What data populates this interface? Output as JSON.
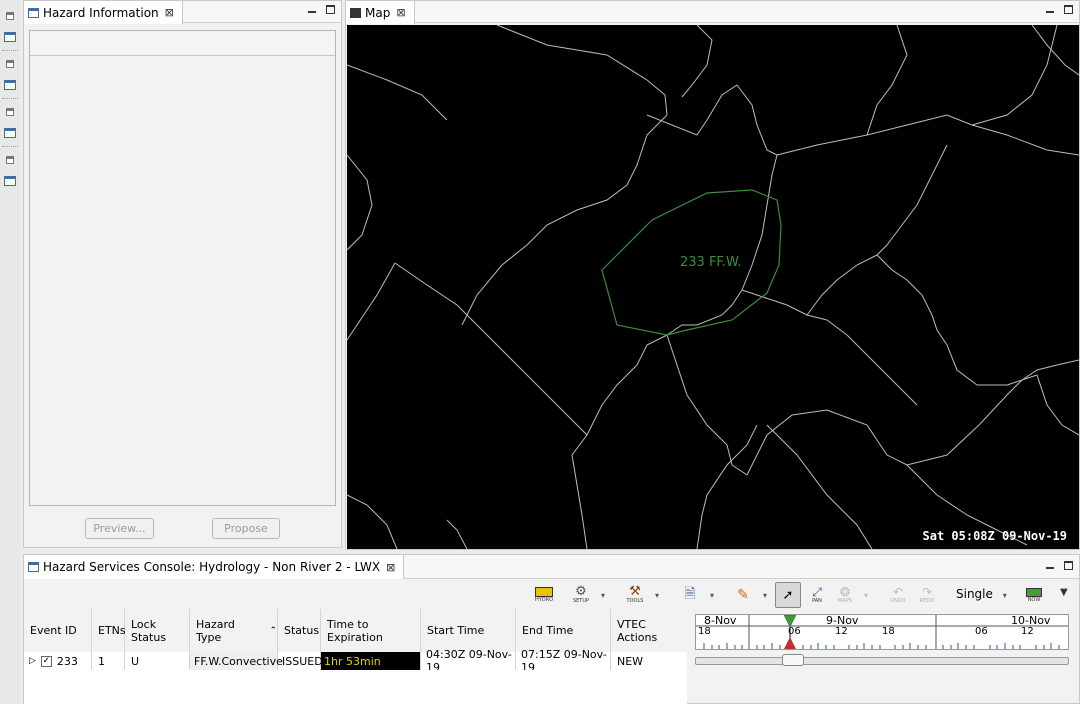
{
  "hazard_info": {
    "tab_title": "Hazard Information",
    "preview_label": "Preview...",
    "propose_label": "Propose"
  },
  "map": {
    "tab_title": "Map",
    "polygon_label": "233 FF.W.",
    "datetime": "Sat 05:08Z 09-Nov-19",
    "polygon_color": "#3a8f3a"
  },
  "console": {
    "tab_title": "Hazard Services Console: Hydrology - Non River 2 - LWX",
    "toolbar": {
      "hydro": "HYDRO",
      "setup": "SETUP",
      "tools": "TOOLS",
      "pan": "PAN",
      "maps": "MAPS",
      "undo": "UNDO",
      "redo": "REDO",
      "mode": "Single",
      "now": "NOW"
    },
    "columns": [
      "Event ID",
      "ETNs",
      "Lock Status",
      "Hazard Type",
      "Status",
      "Time to Expiration",
      "Start Time",
      "End Time",
      "VTEC Actions"
    ],
    "rows": [
      {
        "event_id": "233",
        "checked": true,
        "etns": "1",
        "lock_status": "U",
        "hazard_type": "FF.W.Convective",
        "status": "ISSUED",
        "time_to_expiration": "1hr 53min",
        "start_time": "04:30Z 09-Nov-19",
        "end_time": "07:15Z 09-Nov-19",
        "vtec_actions": "NEW"
      }
    ],
    "timeline": {
      "days": [
        "8-Nov",
        "9-Nov",
        "10-Nov"
      ],
      "hours": [
        "18",
        "06",
        "12",
        "18",
        "06",
        "12"
      ]
    }
  }
}
